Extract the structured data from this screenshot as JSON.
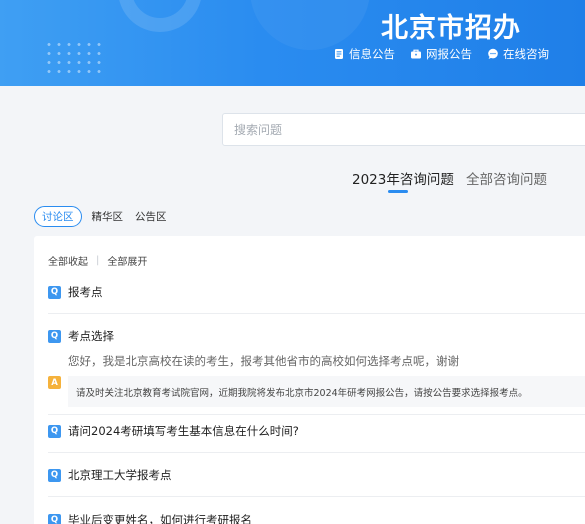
{
  "header": {
    "site_title": "北京市招办",
    "nav": [
      {
        "label": "信息公告",
        "icon": "document-icon"
      },
      {
        "label": "网报公告",
        "icon": "briefcase-icon"
      },
      {
        "label": "在线咨询",
        "icon": "chat-bubble-icon"
      }
    ]
  },
  "search": {
    "placeholder": "搜索问题"
  },
  "tabs": {
    "current": "2023年咨询问题",
    "all": "全部咨询问题"
  },
  "categories": [
    "讨论区",
    "精华区",
    "公告区"
  ],
  "toggles": {
    "collapse_all": "全部收起",
    "expand_all": "全部展开"
  },
  "qa": {
    "badge_q": "Q",
    "badge_a": "A",
    "items": [
      {
        "question": "报考点"
      },
      {
        "question": "考点选择",
        "detail": "您好，我是北京高校在读的考生，报考其他省市的高校如何选择考点呢，谢谢",
        "answer": "请及时关注北京教育考试院官网，近期我院将发布北京市2024年研考网报公告，请按公告要求选择报考点。"
      },
      {
        "question": "请问2024考研填写考生基本信息在什么时间?"
      },
      {
        "question": "北京理工大学报考点"
      },
      {
        "question": "毕业后变更姓名，如何进行考研报名"
      }
    ]
  },
  "colors": {
    "accent": "#2a8cf0",
    "q_badge": "#3d97f0",
    "a_badge": "#f5b23c"
  }
}
